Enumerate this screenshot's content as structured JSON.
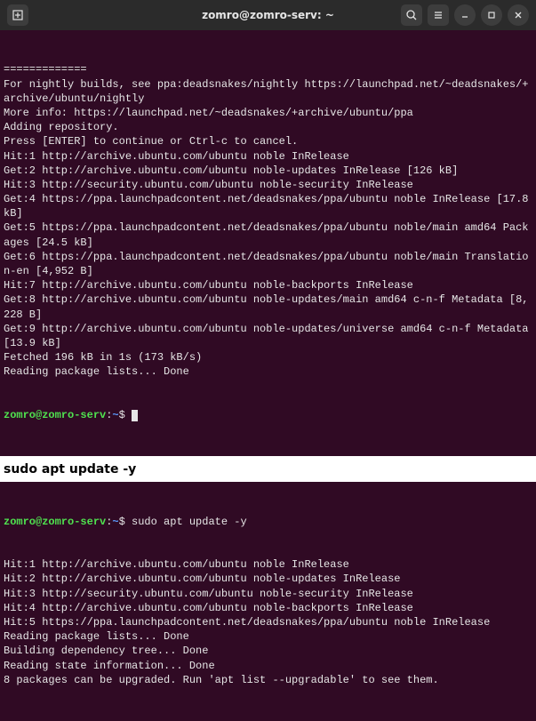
{
  "titlebar": {
    "title": "zomro@zomro-serv: ~",
    "icons": {
      "new_tab": "new-tab-icon",
      "search": "search-icon",
      "menu": "menu-icon",
      "minimize": "minimize-icon",
      "maximize": "maximize-icon",
      "close": "close-icon"
    }
  },
  "prompt": {
    "user_host": "zomro@zomro-serv",
    "path": "~",
    "symbol": "$"
  },
  "term1": {
    "lines": [
      "=============",
      "",
      "For nightly builds, see ppa:deadsnakes/nightly https://launchpad.net/~deadsnakes/+archive/ubuntu/nightly",
      "More info: https://launchpad.net/~deadsnakes/+archive/ubuntu/ppa",
      "Adding repository.",
      "Press [ENTER] to continue or Ctrl-c to cancel.",
      "Hit:1 http://archive.ubuntu.com/ubuntu noble InRelease",
      "Get:2 http://archive.ubuntu.com/ubuntu noble-updates InRelease [126 kB]",
      "Hit:3 http://security.ubuntu.com/ubuntu noble-security InRelease",
      "Get:4 https://ppa.launchpadcontent.net/deadsnakes/ppa/ubuntu noble InRelease [17.8 kB]",
      "Get:5 https://ppa.launchpadcontent.net/deadsnakes/ppa/ubuntu noble/main amd64 Packages [24.5 kB]",
      "Get:6 https://ppa.launchpadcontent.net/deadsnakes/ppa/ubuntu noble/main Translation-en [4,952 B]",
      "Hit:7 http://archive.ubuntu.com/ubuntu noble-backports InRelease",
      "Get:8 http://archive.ubuntu.com/ubuntu noble-updates/main amd64 c-n-f Metadata [8,228 B]",
      "Get:9 http://archive.ubuntu.com/ubuntu noble-updates/universe amd64 c-n-f Metadata [13.9 kB]",
      "Fetched 196 kB in 1s (173 kB/s)",
      "Reading package lists... Done"
    ]
  },
  "section": {
    "label": "sudo apt update -y"
  },
  "term2": {
    "cmd": "sudo apt update -y",
    "lines": [
      "Hit:1 http://archive.ubuntu.com/ubuntu noble InRelease",
      "Hit:2 http://archive.ubuntu.com/ubuntu noble-updates InRelease",
      "Hit:3 http://security.ubuntu.com/ubuntu noble-security InRelease",
      "Hit:4 http://archive.ubuntu.com/ubuntu noble-backports InRelease",
      "Hit:5 https://ppa.launchpadcontent.net/deadsnakes/ppa/ubuntu noble InRelease",
      "Reading package lists... Done",
      "Building dependency tree... Done",
      "Reading state information... Done",
      "8 packages can be upgraded. Run 'apt list --upgradable' to see them."
    ]
  }
}
